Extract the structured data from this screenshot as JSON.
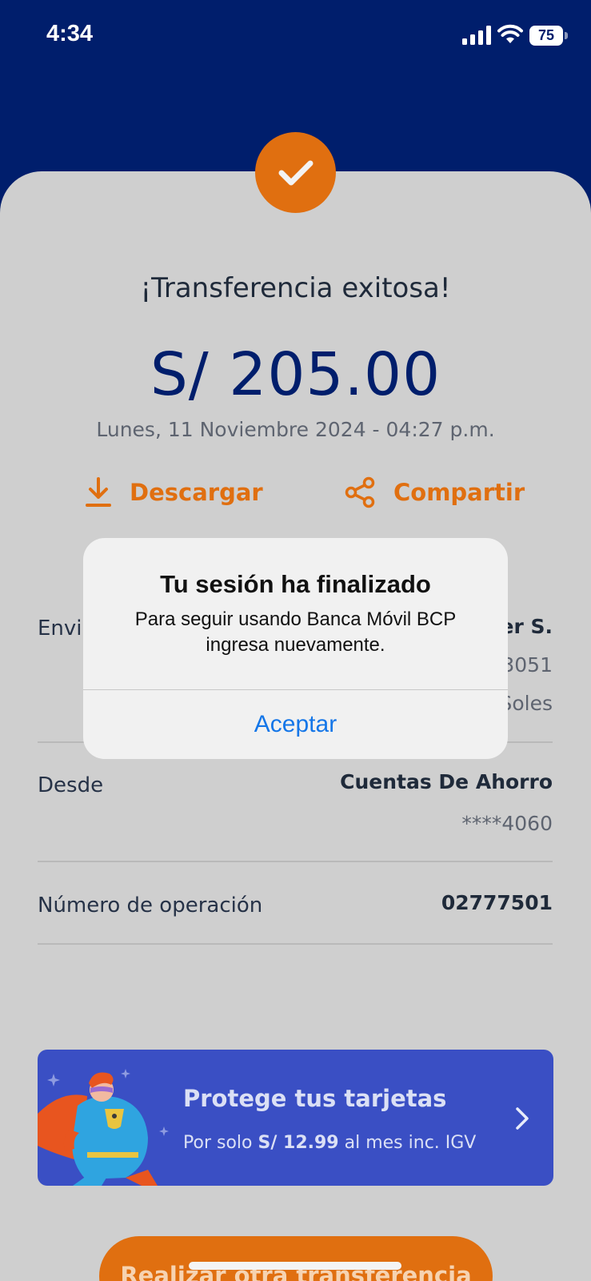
{
  "status_bar": {
    "time": "4:34",
    "battery": "75"
  },
  "receipt": {
    "title": "¡Transferencia exitosa!",
    "amount": "S/ 205.00",
    "date": "Lunes, 11 Noviembre 2024 - 04:27 p.m.",
    "actions": {
      "download": "Descargar",
      "share": "Compartir"
    },
    "rows": {
      "sent_to": {
        "label": "Envia",
        "name": "er S.",
        "account": "3051",
        "currency": "Soles"
      },
      "from": {
        "label": "Desde",
        "account_type": "Cuentas De Ahorro",
        "account_number": "****4060"
      },
      "operation": {
        "label": "Número de operación",
        "value": "02777501"
      }
    }
  },
  "banner": {
    "title": "Protege tus tarjetas",
    "subtitle_prefix": "Por solo",
    "subtitle_price": "S/ 12.99",
    "subtitle_suffix": "al mes inc. IGV"
  },
  "primary_button": {
    "label": "Realizar otra transferencia"
  },
  "alert": {
    "title": "Tu sesión ha finalizado",
    "message": "Para seguir usando Banca Móvil BCP ingresa nuevamente.",
    "button": "Aceptar"
  },
  "colors": {
    "brand_navy": "#001e6c",
    "accent_orange": "#e06f10",
    "ios_link_blue": "#1476e8",
    "banner_blue": "#3a4fc4"
  },
  "icons": [
    "signal-icon",
    "wifi-icon",
    "battery-icon",
    "checkmark-icon",
    "download-icon",
    "share-icon",
    "chevron-right-icon",
    "superhero-illustration"
  ]
}
